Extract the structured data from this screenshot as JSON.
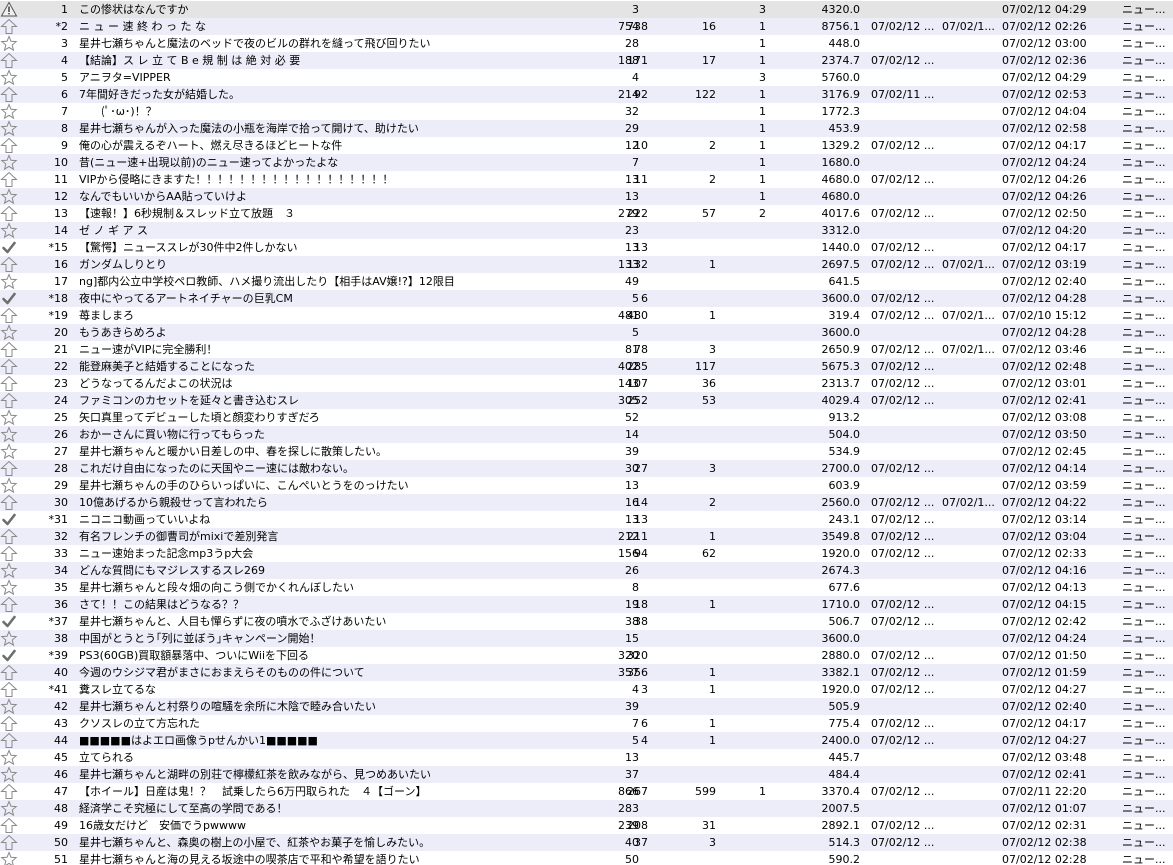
{
  "icon_colors": {
    "outline": "#8a8a8a",
    "warning_fill": "#f0f0f0",
    "check": "#6e6e6e"
  },
  "rows": [
    {
      "icon": "warning-icon",
      "num": "1",
      "title": "この惨状はなんですか",
      "res": "3",
      "read": "",
      "new": "",
      "flag": "3",
      "speed": "4320.0",
      "since": "",
      "last": "",
      "date": "07/02/12 04:29",
      "board": "ニュー..."
    },
    {
      "icon": "arrow-up-icon",
      "num": "*2",
      "title": "ニ ュ ー 速 終 わ っ た な",
      "res": "754",
      "read": "738",
      "new": "16",
      "flag": "1",
      "speed": "8756.1",
      "since": "07/02/12 ...",
      "last": "07/02/1...",
      "date": "07/02/12 02:26",
      "board": "ニュー..."
    },
    {
      "icon": "star-icon",
      "num": "3",
      "title": "星井七瀬ちゃんと魔法のベッドで夜のビルの群れを縫って飛び回りたい",
      "res": "28",
      "read": "",
      "new": "",
      "flag": "1",
      "speed": "448.0",
      "since": "",
      "last": "",
      "date": "07/02/12 03:00",
      "board": "ニュー..."
    },
    {
      "icon": "arrow-up-icon",
      "num": "4",
      "title": "【結論】ス レ 立 て B e 規 制 は 絶 対 必 要",
      "res": "188",
      "read": "171",
      "new": "17",
      "flag": "1",
      "speed": "2374.7",
      "since": "07/02/12 ...",
      "last": "",
      "date": "07/02/12 02:36",
      "board": "ニュー..."
    },
    {
      "icon": "star-icon",
      "num": "5",
      "title": "アニヲタ=VIPPER",
      "res": "4",
      "read": "",
      "new": "",
      "flag": "3",
      "speed": "5760.0",
      "since": "",
      "last": "",
      "date": "07/02/12 04:29",
      "board": "ニュー..."
    },
    {
      "icon": "arrow-up-icon",
      "num": "6",
      "title": "7年間好きだった女が結婚した。",
      "res": "214",
      "read": "92",
      "new": "122",
      "flag": "1",
      "speed": "3176.9",
      "since": "07/02/11 ...",
      "last": "",
      "date": "07/02/12 02:53",
      "board": "ニュー..."
    },
    {
      "icon": "star-icon",
      "num": "7",
      "title": "　　(ﾟ･ω･)！？",
      "res": "32",
      "read": "",
      "new": "",
      "flag": "1",
      "speed": "1772.3",
      "since": "",
      "last": "",
      "date": "07/02/12 04:04",
      "board": "ニュー..."
    },
    {
      "icon": "star-icon",
      "num": "8",
      "title": "星井七瀬ちゃんが入った魔法の小瓶を海岸で拾って開けて、助けたい",
      "res": "29",
      "read": "",
      "new": "",
      "flag": "1",
      "speed": "453.9",
      "since": "",
      "last": "",
      "date": "07/02/12 02:58",
      "board": "ニュー..."
    },
    {
      "icon": "arrow-up-icon",
      "num": "9",
      "title": "俺の心が震えるぞハート、燃え尽きるほどヒートな件",
      "res": "12",
      "read": "10",
      "new": "2",
      "flag": "1",
      "speed": "1329.2",
      "since": "07/02/12 ...",
      "last": "",
      "date": "07/02/12 04:17",
      "board": "ニュー..."
    },
    {
      "icon": "star-icon",
      "num": "10",
      "title": "昔(ニュー速+出現以前)のニュー速ってよかったよな",
      "res": "7",
      "read": "",
      "new": "",
      "flag": "1",
      "speed": "1680.0",
      "since": "",
      "last": "",
      "date": "07/02/12 04:24",
      "board": "ニュー..."
    },
    {
      "icon": "arrow-up-icon",
      "num": "11",
      "title": "VIPから侵略にきますた！！！！！！！！！！！！！！！！！！",
      "res": "13",
      "read": "11",
      "new": "2",
      "flag": "1",
      "speed": "4680.0",
      "since": "07/02/12 ...",
      "last": "",
      "date": "07/02/12 04:26",
      "board": "ニュー..."
    },
    {
      "icon": "star-icon",
      "num": "12",
      "title": "なんでもいいからAA貼っていけよ",
      "res": "13",
      "read": "",
      "new": "",
      "flag": "1",
      "speed": "4680.0",
      "since": "",
      "last": "",
      "date": "07/02/12 04:26",
      "board": "ニュー..."
    },
    {
      "icon": "arrow-up-icon",
      "num": "13",
      "title": "【速報！】6秒規制＆スレッド立て放題　３",
      "res": "279",
      "read": "222",
      "new": "57",
      "flag": "2",
      "speed": "4017.6",
      "since": "07/02/12 ...",
      "last": "",
      "date": "07/02/12 02:50",
      "board": "ニュー..."
    },
    {
      "icon": "star-icon",
      "num": "14",
      "title": "ゼ ノ ギ ア ス",
      "res": "23",
      "read": "",
      "new": "",
      "flag": "",
      "speed": "3312.0",
      "since": "",
      "last": "",
      "date": "07/02/12 04:20",
      "board": "ニュー..."
    },
    {
      "icon": "check-icon",
      "num": "*15",
      "title": "【驚愕】ニューススレが30件中2件しかない",
      "res": "13",
      "read": "13",
      "new": "",
      "flag": "",
      "speed": "1440.0",
      "since": "07/02/12 ...",
      "last": "",
      "date": "07/02/12 04:17",
      "board": "ニュー..."
    },
    {
      "icon": "arrow-up-icon",
      "num": "16",
      "title": "ガンダムしりとり",
      "res": "133",
      "read": "132",
      "new": "1",
      "flag": "",
      "speed": "2697.5",
      "since": "07/02/12 ...",
      "last": "07/02/1...",
      "date": "07/02/12 03:19",
      "board": "ニュー..."
    },
    {
      "icon": "star-icon",
      "num": "17",
      "title": "ng]都内公立中学校ペロ教師、ハメ撮り流出したり【相手はAV嬢!?】12限目",
      "res": "49",
      "read": "",
      "new": "",
      "flag": "",
      "speed": "641.5",
      "since": "",
      "last": "",
      "date": "07/02/12 02:40",
      "board": "ニュー..."
    },
    {
      "icon": "check-icon",
      "num": "*18",
      "title": "夜中にやってるアートネイチャーの巨乳CM",
      "res": "5",
      "read": "6",
      "new": "",
      "flag": "",
      "speed": "3600.0",
      "since": "07/02/12 ...",
      "last": "",
      "date": "07/02/12 04:28",
      "board": "ニュー..."
    },
    {
      "icon": "arrow-up-icon",
      "num": "*19",
      "title": "苺ましまろ",
      "res": "481",
      "read": "480",
      "new": "1",
      "flag": "",
      "speed": "319.4",
      "since": "07/02/12 ...",
      "last": "07/02/1...",
      "date": "07/02/10 15:12",
      "board": "ニュー..."
    },
    {
      "icon": "star-icon",
      "num": "20",
      "title": "もうあきらめろよ",
      "res": "5",
      "read": "",
      "new": "",
      "flag": "",
      "speed": "3600.0",
      "since": "",
      "last": "",
      "date": "07/02/12 04:28",
      "board": "ニュー..."
    },
    {
      "icon": "arrow-up-icon",
      "num": "21",
      "title": "ニュー速がVIPに完全勝利！",
      "res": "81",
      "read": "78",
      "new": "3",
      "flag": "",
      "speed": "2650.9",
      "since": "07/02/12 ...",
      "last": "07/02/1...",
      "date": "07/02/12 03:46",
      "board": "ニュー..."
    },
    {
      "icon": "arrow-up-icon",
      "num": "22",
      "title": "能登麻美子と結婚することになった",
      "res": "402",
      "read": "285",
      "new": "117",
      "flag": "",
      "speed": "5675.3",
      "since": "07/02/12 ...",
      "last": "",
      "date": "07/02/12 02:48",
      "board": "ニュー..."
    },
    {
      "icon": "arrow-up-icon",
      "num": "23",
      "title": "どうなってるんだよこの状況は",
      "res": "143",
      "read": "107",
      "new": "36",
      "flag": "",
      "speed": "2313.7",
      "since": "07/02/12 ...",
      "last": "",
      "date": "07/02/12 03:01",
      "board": "ニュー..."
    },
    {
      "icon": "arrow-up-icon",
      "num": "24",
      "title": "ファミコンのカセットを延々と書き込むスレ",
      "res": "305",
      "read": "252",
      "new": "53",
      "flag": "",
      "speed": "4029.4",
      "since": "07/02/12 ...",
      "last": "",
      "date": "07/02/12 02:41",
      "board": "ニュー..."
    },
    {
      "icon": "star-icon",
      "num": "25",
      "title": "矢口真里ってデビューした頃と顔変わりすぎだろ",
      "res": "52",
      "read": "",
      "new": "",
      "flag": "",
      "speed": "913.2",
      "since": "",
      "last": "",
      "date": "07/02/12 03:08",
      "board": "ニュー..."
    },
    {
      "icon": "star-icon",
      "num": "26",
      "title": "おかーさんに買い物に行ってもらった",
      "res": "14",
      "read": "",
      "new": "",
      "flag": "",
      "speed": "504.0",
      "since": "",
      "last": "",
      "date": "07/02/12 03:50",
      "board": "ニュー..."
    },
    {
      "icon": "star-icon",
      "num": "27",
      "title": "星井七瀬ちゃんと暖かい日差しの中、春を探しに散策したい。",
      "res": "39",
      "read": "",
      "new": "",
      "flag": "",
      "speed": "534.9",
      "since": "",
      "last": "",
      "date": "07/02/12 02:45",
      "board": "ニュー..."
    },
    {
      "icon": "arrow-up-icon",
      "num": "28",
      "title": "これだけ自由になったのに天国やニー速には敵わない。",
      "res": "30",
      "read": "27",
      "new": "3",
      "flag": "",
      "speed": "2700.0",
      "since": "07/02/12 ...",
      "last": "",
      "date": "07/02/12 04:14",
      "board": "ニュー..."
    },
    {
      "icon": "star-icon",
      "num": "29",
      "title": "星井七瀬ちゃんの手のひらいっぱいに、こんぺいとうをのっけたい",
      "res": "13",
      "read": "",
      "new": "",
      "flag": "",
      "speed": "603.9",
      "since": "",
      "last": "",
      "date": "07/02/12 03:59",
      "board": "ニュー..."
    },
    {
      "icon": "arrow-up-icon",
      "num": "30",
      "title": "10億あげるから親殺せって言われたら",
      "res": "16",
      "read": "14",
      "new": "2",
      "flag": "",
      "speed": "2560.0",
      "since": "07/02/12 ...",
      "last": "07/02/1...",
      "date": "07/02/12 04:22",
      "board": "ニュー..."
    },
    {
      "icon": "check-icon",
      "num": "*31",
      "title": "ニコニコ動画っていいよね",
      "res": "13",
      "read": "13",
      "new": "",
      "flag": "",
      "speed": "243.1",
      "since": "07/02/12 ...",
      "last": "",
      "date": "07/02/12 03:14",
      "board": "ニュー..."
    },
    {
      "icon": "arrow-up-icon",
      "num": "32",
      "title": "有名フレンチの御曹司がmixiで差別発言",
      "res": "212",
      "read": "211",
      "new": "1",
      "flag": "",
      "speed": "3549.8",
      "since": "07/02/12 ...",
      "last": "",
      "date": "07/02/12 03:04",
      "board": "ニュー..."
    },
    {
      "icon": "arrow-up-icon",
      "num": "33",
      "title": "ニュー速始まった記念mp3うp大会",
      "res": "156",
      "read": "94",
      "new": "62",
      "flag": "",
      "speed": "1920.0",
      "since": "07/02/12 ...",
      "last": "",
      "date": "07/02/12 02:33",
      "board": "ニュー..."
    },
    {
      "icon": "star-icon",
      "num": "34",
      "title": "どんな質問にもマジレスするスレ269",
      "res": "26",
      "read": "",
      "new": "",
      "flag": "",
      "speed": "2674.3",
      "since": "",
      "last": "",
      "date": "07/02/12 04:16",
      "board": "ニュー..."
    },
    {
      "icon": "star-icon",
      "num": "35",
      "title": "星井七瀬ちゃんと段々畑の向こう側でかくれんぼしたい",
      "res": "8",
      "read": "",
      "new": "",
      "flag": "",
      "speed": "677.6",
      "since": "",
      "last": "",
      "date": "07/02/12 04:13",
      "board": "ニュー..."
    },
    {
      "icon": "arrow-up-icon",
      "num": "36",
      "title": "さて！！この結果はどうなる？？",
      "res": "19",
      "read": "18",
      "new": "1",
      "flag": "",
      "speed": "1710.0",
      "since": "07/02/12 ...",
      "last": "",
      "date": "07/02/12 04:15",
      "board": "ニュー..."
    },
    {
      "icon": "check-icon",
      "num": "*37",
      "title": "星井七瀬ちゃんと、人目も憚らずに夜の噴水でふざけあいたい",
      "res": "38",
      "read": "38",
      "new": "",
      "flag": "",
      "speed": "506.7",
      "since": "07/02/12 ...",
      "last": "",
      "date": "07/02/12 02:42",
      "board": "ニュー..."
    },
    {
      "icon": "star-icon",
      "num": "38",
      "title": "中国がとうとう｢列に並ぼう｣キャンペーン開始！",
      "res": "15",
      "read": "",
      "new": "",
      "flag": "",
      "speed": "3600.0",
      "since": "",
      "last": "",
      "date": "07/02/12 04:24",
      "board": "ニュー..."
    },
    {
      "icon": "check-icon",
      "num": "*39",
      "title": "PS3(60GB)買取額暴落中、ついにWiiを下回る",
      "res": "320",
      "read": "320",
      "new": "",
      "flag": "",
      "speed": "2880.0",
      "since": "07/02/12 ...",
      "last": "",
      "date": "07/02/12 01:50",
      "board": "ニュー..."
    },
    {
      "icon": "arrow-up-icon",
      "num": "40",
      "title": "今週のウシジマ君がまさにおまえらそのものの件について",
      "res": "357",
      "read": "356",
      "new": "1",
      "flag": "",
      "speed": "3382.1",
      "since": "07/02/12 ...",
      "last": "",
      "date": "07/02/12 01:59",
      "board": "ニュー..."
    },
    {
      "icon": "arrow-up-icon",
      "num": "*41",
      "title": "糞スレ立てるな",
      "res": "4",
      "read": "3",
      "new": "1",
      "flag": "",
      "speed": "1920.0",
      "since": "07/02/12 ...",
      "last": "",
      "date": "07/02/12 04:27",
      "board": "ニュー..."
    },
    {
      "icon": "star-icon",
      "num": "42",
      "title": "星井七瀬ちゃんと村祭りの喧騒を余所に木陰で睦み合いたい",
      "res": "39",
      "read": "",
      "new": "",
      "flag": "",
      "speed": "505.9",
      "since": "",
      "last": "",
      "date": "07/02/12 02:40",
      "board": "ニュー..."
    },
    {
      "icon": "arrow-up-icon",
      "num": "43",
      "title": "クソスレの立て方忘れた",
      "res": "7",
      "read": "6",
      "new": "1",
      "flag": "",
      "speed": "775.4",
      "since": "07/02/12 ...",
      "last": "",
      "date": "07/02/12 04:17",
      "board": "ニュー..."
    },
    {
      "icon": "arrow-up-icon",
      "num": "44",
      "title": "■■■■■はよエロ画像うpせんかい1■■■■■",
      "res": "5",
      "read": "4",
      "new": "1",
      "flag": "",
      "speed": "2400.0",
      "since": "07/02/12 ...",
      "last": "",
      "date": "07/02/12 04:27",
      "board": "ニュー..."
    },
    {
      "icon": "star-icon",
      "num": "45",
      "title": "立てられる",
      "res": "13",
      "read": "",
      "new": "",
      "flag": "",
      "speed": "445.7",
      "since": "",
      "last": "",
      "date": "07/02/12 03:48",
      "board": "ニュー..."
    },
    {
      "icon": "star-icon",
      "num": "46",
      "title": "星井七瀬ちゃんと湖畔の別荘で檸檬紅茶を飲みながら、見つめあいたい",
      "res": "37",
      "read": "",
      "new": "",
      "flag": "",
      "speed": "484.4",
      "since": "",
      "last": "",
      "date": "07/02/12 02:41",
      "board": "ニュー..."
    },
    {
      "icon": "arrow-up-icon",
      "num": "47",
      "title": "【ホイール】日産は鬼！？　試乗したら6万円取られた　４【ゴーン】",
      "res": "866",
      "read": "267",
      "new": "599",
      "flag": "1",
      "speed": "3370.4",
      "since": "07/02/12 ...",
      "last": "",
      "date": "07/02/11 22:20",
      "board": "ニュー..."
    },
    {
      "icon": "star-icon",
      "num": "48",
      "title": "経済学こそ究極にして至高の学問である！",
      "res": "283",
      "read": "",
      "new": "",
      "flag": "",
      "speed": "2007.5",
      "since": "",
      "last": "",
      "date": "07/02/12 01:07",
      "board": "ニュー..."
    },
    {
      "icon": "arrow-up-icon",
      "num": "49",
      "title": "16歳女だけど　安価でうpwwww",
      "res": "239",
      "read": "208",
      "new": "31",
      "flag": "",
      "speed": "2892.1",
      "since": "07/02/12 ...",
      "last": "",
      "date": "07/02/12 02:31",
      "board": "ニュー..."
    },
    {
      "icon": "arrow-up-icon",
      "num": "50",
      "title": "星井七瀬ちゃんと、森奥の樹上の小屋で、紅茶やお菓子を愉しみたい。",
      "res": "40",
      "read": "37",
      "new": "3",
      "flag": "",
      "speed": "514.3",
      "since": "07/02/12 ...",
      "last": "",
      "date": "07/02/12 02:38",
      "board": "ニュー..."
    },
    {
      "icon": "star-icon",
      "num": "51",
      "title": "星井七瀬ちゃんと海の見える坂途中の喫茶店で平和や希望を語りたい",
      "res": "50",
      "read": "",
      "new": "",
      "flag": "",
      "speed": "590.2",
      "since": "",
      "last": "",
      "date": "07/02/12 02:28",
      "board": "ニュー..."
    }
  ]
}
